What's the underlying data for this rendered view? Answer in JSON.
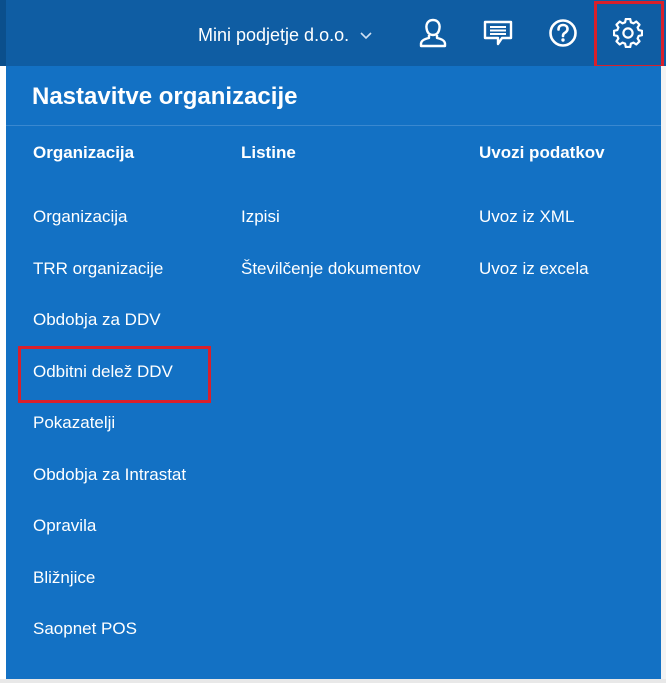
{
  "header": {
    "company_name": "Mini podjetje d.o.o.",
    "icons": [
      "chevron-down-icon",
      "user-icon",
      "message-icon",
      "help-icon",
      "settings-icon"
    ]
  },
  "menu": {
    "title": "Nastavitve organizacije",
    "columns": [
      {
        "heading": "Organizacija",
        "items": [
          "Organizacija",
          "TRR organizacije",
          "Obdobja za DDV",
          "Odbitni delež DDV",
          "Pokazatelji",
          "Obdobja za Intrastat",
          "Opravila",
          "Bližnjice",
          "Saopnet POS"
        ]
      },
      {
        "heading": "Listine",
        "items": [
          "Izpisi",
          "Številčenje dokumentov"
        ]
      },
      {
        "heading": "Uvozi podatkov",
        "items": [
          "Uvoz iz XML",
          "Uvoz iz excela"
        ]
      }
    ]
  },
  "colors": {
    "topbar": "#0f5da3",
    "panel": "#1371c4",
    "highlight": "#d9202b",
    "text": "#ffffff"
  }
}
